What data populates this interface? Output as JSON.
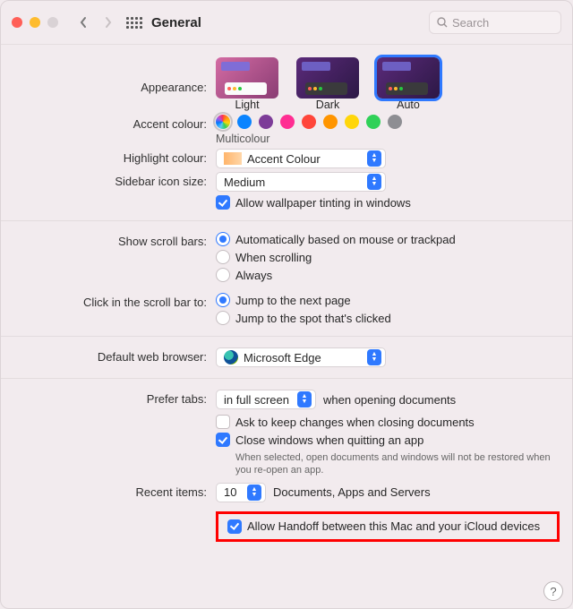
{
  "titlebar": {
    "title": "General",
    "search_placeholder": "Search"
  },
  "appearance": {
    "label": "Appearance:",
    "options": [
      "Light",
      "Dark",
      "Auto"
    ],
    "selected": "Auto"
  },
  "accent": {
    "label": "Accent colour:",
    "colors": [
      "multi",
      "#0a84ff",
      "#7d3c98",
      "#ff2d92",
      "#ff453a",
      "#ff9500",
      "#ffd60a",
      "#30d158",
      "#8e8e93"
    ],
    "caption": "Multicolour"
  },
  "highlight": {
    "label": "Highlight colour:",
    "value": "Accent Colour"
  },
  "sidebar": {
    "label": "Sidebar icon size:",
    "value": "Medium"
  },
  "wallpaper_tint": {
    "checked": true,
    "label": "Allow wallpaper tinting in windows"
  },
  "scrollbars": {
    "label": "Show scroll bars:",
    "options": [
      "Automatically based on mouse or trackpad",
      "When scrolling",
      "Always"
    ],
    "selected": 0
  },
  "clickscroll": {
    "label": "Click in the scroll bar to:",
    "options": [
      "Jump to the next page",
      "Jump to the spot that's clicked"
    ],
    "selected": 0
  },
  "browser": {
    "label": "Default web browser:",
    "value": "Microsoft Edge"
  },
  "tabs": {
    "label": "Prefer tabs:",
    "select": "in full screen",
    "suffix": "when opening documents"
  },
  "ask_keep": {
    "checked": false,
    "label": "Ask to keep changes when closing documents"
  },
  "close_windows": {
    "checked": true,
    "label": "Close windows when quitting an app",
    "note": "When selected, open documents and windows will not be restored when you re-open an app."
  },
  "recent": {
    "label": "Recent items:",
    "value": "10",
    "suffix": "Documents, Apps and Servers"
  },
  "handoff": {
    "checked": true,
    "label": "Allow Handoff between this Mac and your iCloud devices"
  }
}
